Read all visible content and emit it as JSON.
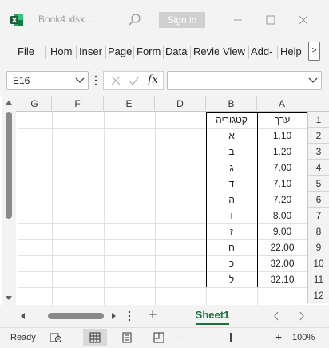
{
  "app": {
    "title": "Book4.xlsx...",
    "signin_label": "Sign in",
    "brand_color": "#1d6f42"
  },
  "menu": {
    "items": [
      "File",
      "Hom",
      "Inser",
      "Page",
      "Form",
      "Data",
      "Revie",
      "View",
      "Add-",
      "Help"
    ],
    "more_label": ">"
  },
  "formula": {
    "namebox": "E16",
    "fx_label": "fx",
    "value": ""
  },
  "sheet": {
    "columns": [
      "G",
      "F",
      "E",
      "D",
      "B",
      "A"
    ],
    "rows": [
      "1",
      "2",
      "3",
      "4",
      "5",
      "6",
      "7",
      "8",
      "9",
      "10",
      "11",
      "12"
    ],
    "table": {
      "header": [
        "ערך",
        "קטגוריה"
      ],
      "rows": [
        [
          "1.10",
          "א"
        ],
        [
          "1.20",
          "ב"
        ],
        [
          "7.00",
          "ג"
        ],
        [
          "7.10",
          "ד"
        ],
        [
          "7.20",
          "ה"
        ],
        [
          "8.00",
          "ו"
        ],
        [
          "9.00",
          "ז"
        ],
        [
          "22.00",
          "ח"
        ],
        [
          "32.00",
          "כ"
        ],
        [
          "32.10",
          "ל"
        ]
      ]
    }
  },
  "tabs": {
    "active": "Sheet1",
    "add_label": "+"
  },
  "status": {
    "ready": "Ready",
    "zoom": "100%"
  },
  "icons": [
    "excel-logo-icon",
    "search-icon",
    "minimize-icon",
    "maximize-icon",
    "close-icon",
    "chevron-down-icon",
    "cancel-x-icon",
    "check-icon",
    "fx-icon",
    "scroll-left-icon",
    "scroll-right-icon",
    "more-dots-icon",
    "add-sheet-icon",
    "accessibility-icon",
    "normal-view-icon",
    "page-layout-icon",
    "page-break-icon",
    "zoom-out-icon",
    "zoom-in-icon"
  ]
}
